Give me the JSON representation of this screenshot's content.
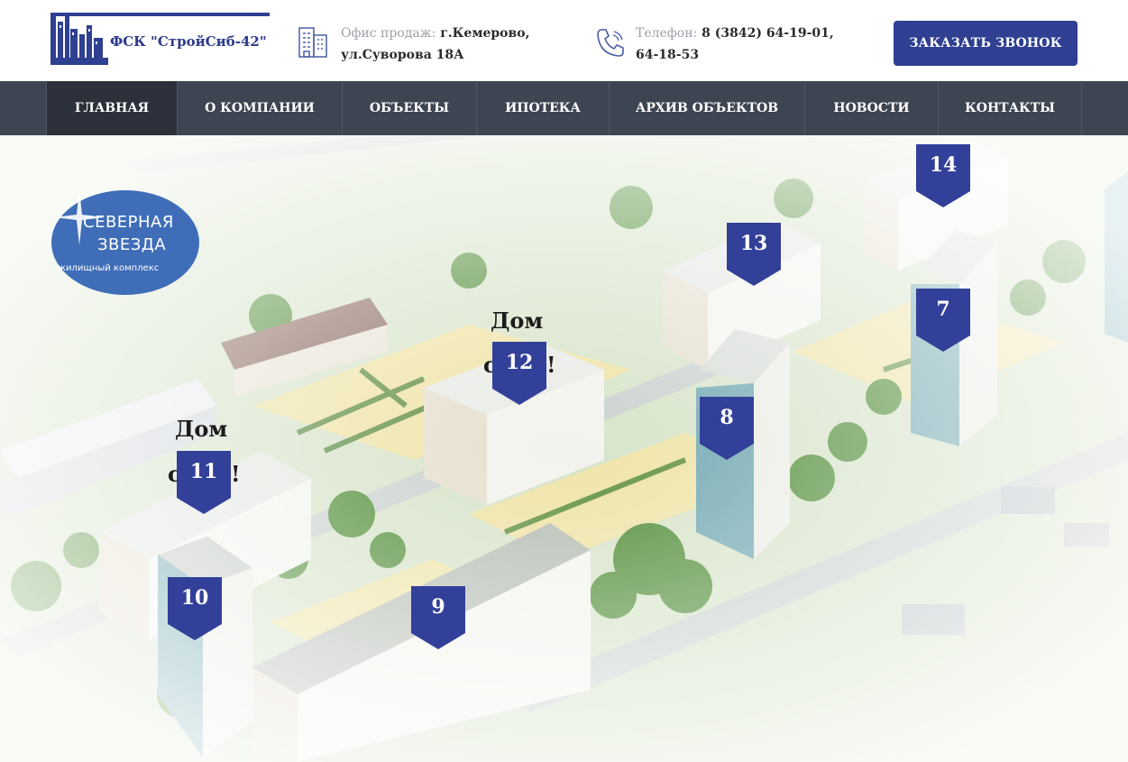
{
  "header": {
    "company_name": "ФСК \"СтройСиб-42\"",
    "office_label": "Офис продаж:",
    "office_city": "г.Кемерово,",
    "office_street": "ул.Суворова 18А",
    "phone_label": "Телефон:",
    "phone_1": "8 (3842) 64-19-01,",
    "phone_2": "64-18-53",
    "cta_label": "ЗАКАЗАТЬ ЗВОНОК"
  },
  "nav": {
    "items": [
      {
        "label": "ГЛАВНАЯ",
        "active": true
      },
      {
        "label": "О КОМПАНИИ"
      },
      {
        "label": "ОБЪЕКТЫ"
      },
      {
        "label": "ИПОТЕКА"
      },
      {
        "label": "АРХИВ ОБЪЕКТОВ"
      },
      {
        "label": "НОВОСТИ"
      },
      {
        "label": "КОНТАКТЫ"
      }
    ]
  },
  "hero": {
    "emblem": {
      "line1": "СЕВЕРНАЯ",
      "line2": "ЗВЕЗДА",
      "line3": "жилищный комплекс"
    },
    "markers": [
      "14",
      "13",
      "12",
      "7",
      "8",
      "11",
      "10",
      "9"
    ],
    "dom_labels": [
      {
        "word": "Дом",
        "tail": "с",
        "excl": "!"
      },
      {
        "word": "Дом",
        "tail": "с",
        "excl": "!"
      }
    ]
  },
  "colors": {
    "accent": "#2f3f91",
    "nav_bg": "#3d4452",
    "nav_active": "#2b303b",
    "marker": "#33409a"
  },
  "icons": [
    "building-icon",
    "phone-icon",
    "company-logo-icon"
  ]
}
